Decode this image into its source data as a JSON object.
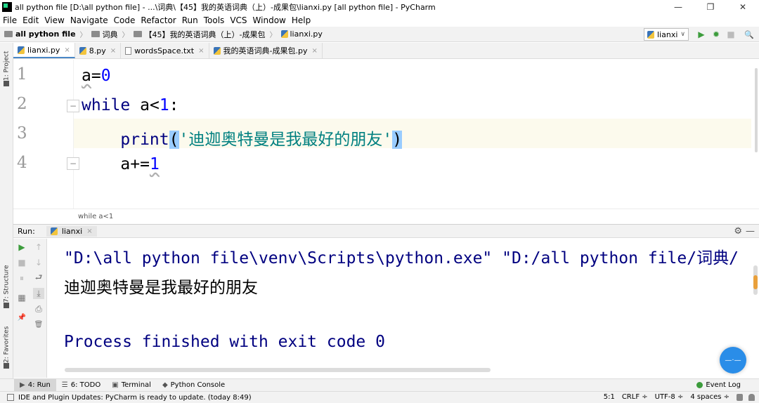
{
  "window": {
    "title": "all python file [D:\\all python file] - ...\\词典\\【45】我的英语词典（上）-成果包\\lianxi.py [all python file] - PyCharm",
    "min_glyph": "—",
    "max_glyph": "❐",
    "close_glyph": "✕"
  },
  "menu": [
    "File",
    "Edit",
    "View",
    "Navigate",
    "Code",
    "Refactor",
    "Run",
    "Tools",
    "VCS",
    "Window",
    "Help"
  ],
  "nav": {
    "crumbs": [
      "all python file",
      "词典",
      "【45】我的英语词典（上）-成果包",
      "lianxi.py"
    ],
    "separator": "〉",
    "run_config": "lianxi",
    "run_config_chevron": "∨"
  },
  "toolbar_icons": {
    "run": "▶",
    "debug": "✹",
    "stop": "■",
    "search": "🔍"
  },
  "left_stripe": {
    "project": "1: Project",
    "structure": "7: Structure",
    "favorites": "2: Favorites"
  },
  "editor_tabs": [
    {
      "label": "lianxi.py",
      "type": "py",
      "close": "×"
    },
    {
      "label": "8.py",
      "type": "py",
      "close": "×"
    },
    {
      "label": "wordsSpace.txt",
      "type": "txt",
      "close": "×"
    },
    {
      "label": "我的英语词典-成果包.py",
      "type": "py",
      "close": "×"
    }
  ],
  "code": {
    "line_numbers": [
      "1",
      "2",
      "3",
      "4"
    ],
    "line1": {
      "var": "a",
      "op": "=",
      "num": "0"
    },
    "line2": {
      "kw": "while",
      "var": " a",
      "op": "<",
      "num": "1",
      "colon": ":"
    },
    "line3": {
      "indent": "    ",
      "func": "print",
      "open": "(",
      "str": "'迪迦奥特曼是我最好的朋友'",
      "close": ")"
    },
    "line4": {
      "indent": "    ",
      "var": "a",
      "op": "+=",
      "num": "1"
    },
    "fold_open": "−",
    "fold_close": "−"
  },
  "code_breadcrumb": "while a<1",
  "run_panel": {
    "label": "Run:",
    "tab": "lianxi",
    "close": "×",
    "gear": "⚙",
    "minimize": "—",
    "console": {
      "command": "\"D:\\all python file\\venv\\Scripts\\python.exe\" \"D:/all python file/词典/",
      "output": "迪迦奥特曼是我最好的朋友",
      "finished": "Process finished with exit code 0"
    },
    "toolbar_glyphs": {
      "rerun": "▶",
      "stop": "■",
      "pause": "⏸",
      "layout": "▦",
      "pin": "📌",
      "up": "↑",
      "down": "↓",
      "wrap": "⮐",
      "scroll_end": "⤓",
      "print": "⎙",
      "trash": "🗑"
    }
  },
  "floating_ball": "—·—",
  "bottom_tools": [
    {
      "label": "4: Run",
      "icon": "▶",
      "active": true
    },
    {
      "label": "6: TODO",
      "icon": "☰",
      "active": false
    },
    {
      "label": "Terminal",
      "icon": "▣",
      "active": false
    },
    {
      "label": "Python Console",
      "icon": "◆",
      "active": false
    }
  ],
  "event_log": "Event Log",
  "status": {
    "message": "IDE and Plugin Updates: PyCharm is ready to update. (today 8:49)",
    "position": "5:1",
    "line_sep": "CRLF ÷",
    "encoding": "UTF-8 ÷",
    "indent": "4 spaces ÷"
  },
  "colors": {
    "keyword": "#000080",
    "number": "#0000ff",
    "string": "#008080",
    "caret_line": "#fcfaed",
    "paren_highlight": "#99ccff"
  }
}
